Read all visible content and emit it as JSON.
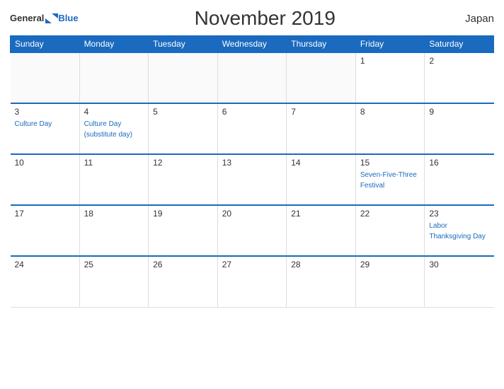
{
  "header": {
    "logo_general": "General",
    "logo_blue": "Blue",
    "title": "November 2019",
    "country": "Japan"
  },
  "weekdays": [
    "Sunday",
    "Monday",
    "Tuesday",
    "Wednesday",
    "Thursday",
    "Friday",
    "Saturday"
  ],
  "weeks": [
    [
      {
        "day": "",
        "events": []
      },
      {
        "day": "",
        "events": []
      },
      {
        "day": "",
        "events": []
      },
      {
        "day": "",
        "events": []
      },
      {
        "day": "",
        "events": []
      },
      {
        "day": "1",
        "events": []
      },
      {
        "day": "2",
        "events": []
      }
    ],
    [
      {
        "day": "3",
        "events": [
          "Culture Day"
        ]
      },
      {
        "day": "4",
        "events": [
          "Culture Day",
          "(substitute day)"
        ]
      },
      {
        "day": "5",
        "events": []
      },
      {
        "day": "6",
        "events": []
      },
      {
        "day": "7",
        "events": []
      },
      {
        "day": "8",
        "events": []
      },
      {
        "day": "9",
        "events": []
      }
    ],
    [
      {
        "day": "10",
        "events": []
      },
      {
        "day": "11",
        "events": []
      },
      {
        "day": "12",
        "events": []
      },
      {
        "day": "13",
        "events": []
      },
      {
        "day": "14",
        "events": []
      },
      {
        "day": "15",
        "events": [
          "Seven-Five-Three",
          "Festival"
        ]
      },
      {
        "day": "16",
        "events": []
      }
    ],
    [
      {
        "day": "17",
        "events": []
      },
      {
        "day": "18",
        "events": []
      },
      {
        "day": "19",
        "events": []
      },
      {
        "day": "20",
        "events": []
      },
      {
        "day": "21",
        "events": []
      },
      {
        "day": "22",
        "events": []
      },
      {
        "day": "23",
        "events": [
          "Labor",
          "Thanksgiving Day"
        ]
      }
    ],
    [
      {
        "day": "24",
        "events": []
      },
      {
        "day": "25",
        "events": []
      },
      {
        "day": "26",
        "events": []
      },
      {
        "day": "27",
        "events": []
      },
      {
        "day": "28",
        "events": []
      },
      {
        "day": "29",
        "events": []
      },
      {
        "day": "30",
        "events": []
      }
    ]
  ],
  "colors": {
    "header_bg": "#1a6abf",
    "accent": "#1a6abf"
  }
}
